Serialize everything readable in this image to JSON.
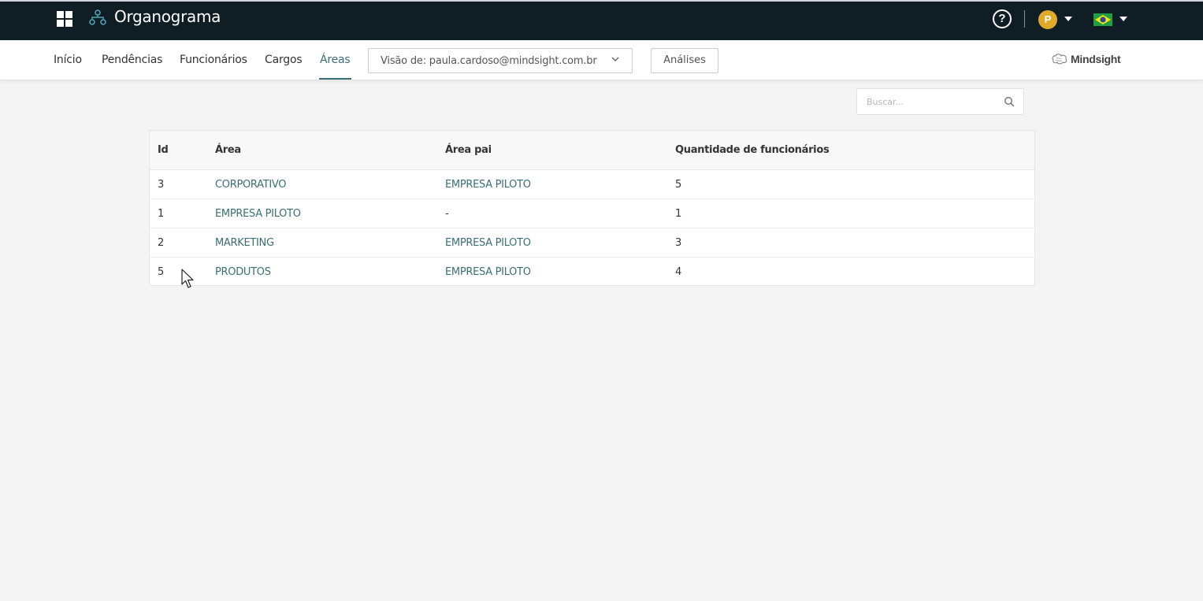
{
  "header": {
    "app_title": "Organograma",
    "avatar_initial": "P",
    "help_symbol": "?"
  },
  "nav": {
    "items": [
      {
        "label": "Início"
      },
      {
        "label": "Pendências"
      },
      {
        "label": "Funcionários"
      },
      {
        "label": "Cargos"
      },
      {
        "label": "Áreas",
        "active": true
      }
    ],
    "view_select": "Visão de: paula.cardoso@mindsight.com.br",
    "analises_label": "Análises",
    "brand": "Mindsight"
  },
  "search": {
    "placeholder": "Buscar..."
  },
  "table": {
    "headers": [
      "Id",
      "Área",
      "Área pai",
      "Quantidade de funcionários"
    ],
    "rows": [
      {
        "id": "3",
        "area": "CORPORATIVO",
        "parent": "EMPRESA PILOTO",
        "qty": "5"
      },
      {
        "id": "1",
        "area": "EMPRESA PILOTO",
        "parent": "-",
        "qty": "1"
      },
      {
        "id": "2",
        "area": "MARKETING",
        "parent": "EMPRESA PILOTO",
        "qty": "3"
      },
      {
        "id": "5",
        "area": "PRODUTOS",
        "parent": "EMPRESA PILOTO",
        "qty": "4"
      }
    ]
  },
  "colors": {
    "topbar": "#0f1d24",
    "accent": "#3a6e75",
    "avatar": "#e0a92a"
  },
  "icons": [
    "apps-grid-icon",
    "org-chart-icon",
    "help-icon",
    "chevron-down-icon",
    "brazil-flag-icon",
    "search-icon",
    "brain-logo-icon",
    "mouse-cursor-icon"
  ]
}
